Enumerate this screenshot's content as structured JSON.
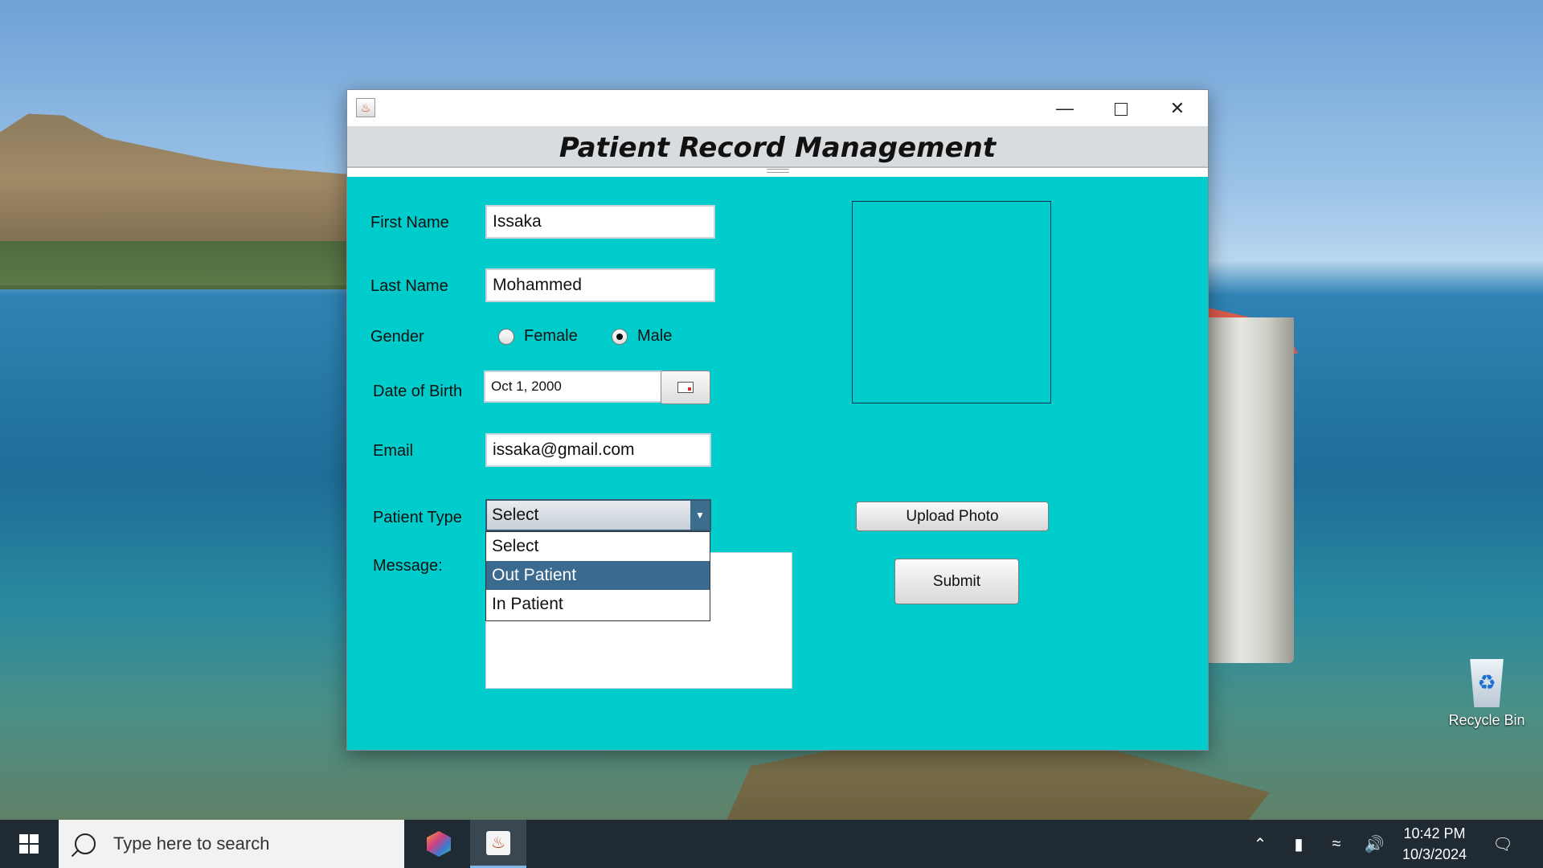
{
  "desktop": {
    "recycle_bin_label": "Recycle Bin"
  },
  "window": {
    "title": "",
    "header_title": "Patient Record Management"
  },
  "form": {
    "first_name_label": "First Name",
    "first_name_value": "Issaka",
    "last_name_label": "Last Name",
    "last_name_value": "Mohammed",
    "gender_label": "Gender",
    "gender_options": [
      "Female",
      "Male"
    ],
    "gender_selected": "Male",
    "dob_label": "Date of Birth",
    "dob_value": "Oct 1, 2000",
    "email_label": "Email",
    "email_value": "issaka@gmail.com",
    "patient_type_label": "Patient Type",
    "patient_type_value": "Select",
    "patient_type_options": [
      "Select",
      "Out Patient",
      "In Patient"
    ],
    "patient_type_highlighted": "Out Patient",
    "message_label": "Message:",
    "message_value": "",
    "upload_button": "Upload Photo",
    "submit_button": "Submit"
  },
  "taskbar": {
    "search_placeholder": "Type here to search",
    "time": "10:42 PM",
    "date": "10/3/2024"
  },
  "colors": {
    "form_background": "#00cccc",
    "header_background": "#d9dcdf",
    "dropdown_highlight": "#3b6a8f"
  }
}
